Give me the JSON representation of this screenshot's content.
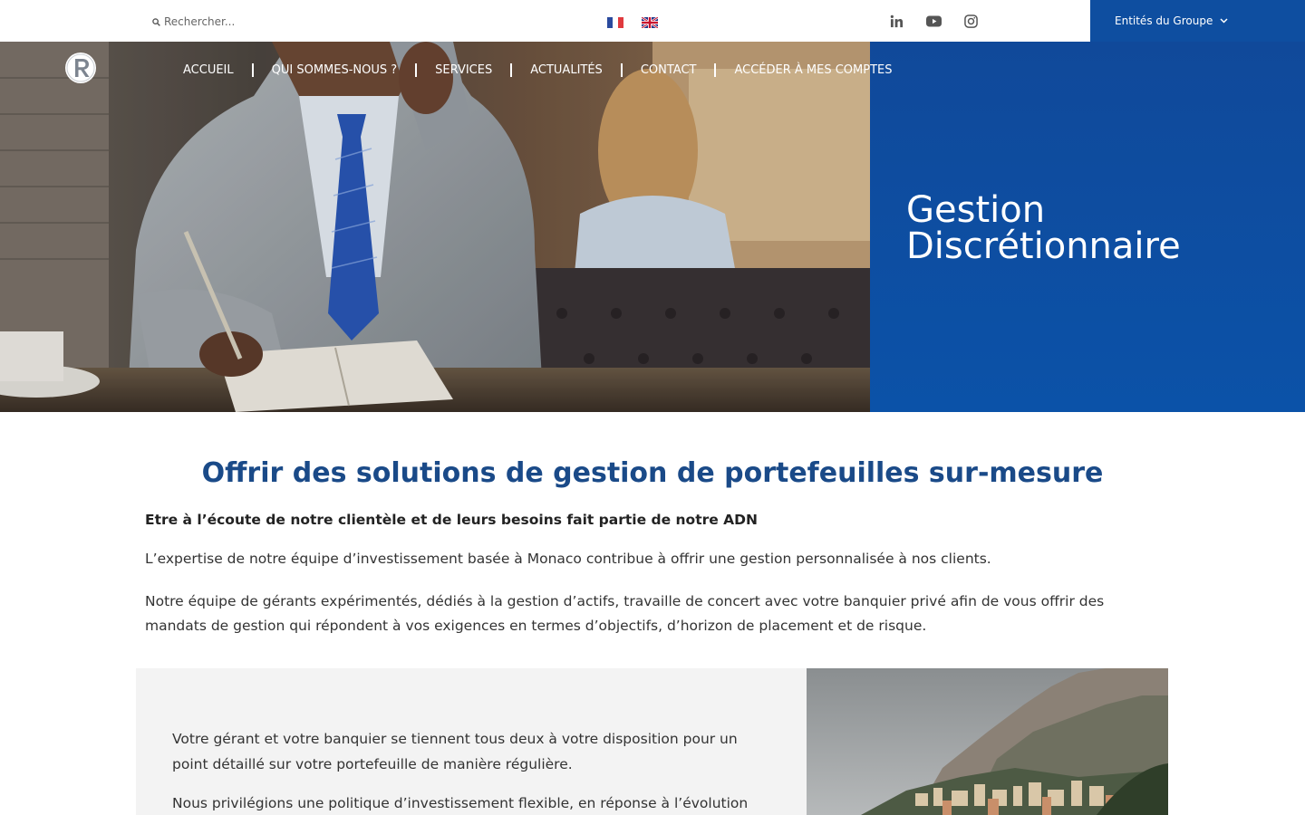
{
  "topbar": {
    "search_placeholder": "Rechercher...",
    "languages": [
      "fr",
      "en"
    ],
    "socials": [
      "linkedin-icon",
      "youtube-icon",
      "instagram-icon"
    ],
    "entities_label": "Entités du Groupe"
  },
  "nav": {
    "items": [
      "ACCUEIL",
      "QUI SOMMES-NOUS ?",
      "SERVICES",
      "ACTUALITÉS",
      "CONTACT",
      "ACCÉDER À MES COMPTES"
    ]
  },
  "hero": {
    "title_line1": "Gestion",
    "title_line2": "Discrétionnaire"
  },
  "content": {
    "headline": "Offrir des solutions de gestion de portefeuilles sur-mesure",
    "lead": "Etre à l’écoute de notre clientèle et de leurs besoins fait partie de notre ADN",
    "para1": "L’expertise de notre équipe d’investissement basée à Monaco contribue à offrir une gestion personnalisée à nos clients.",
    "para2": "Notre équipe de gérants expérimentés, dédiés à la gestion d’actifs, travaille de concert avec votre banquier privé afin de vous offrir des mandats de gestion qui répondent à vos exigences en termes d’objectifs, d’horizon de placement et de risque.",
    "card_para1": "Votre gérant et votre banquier se tiennent tous deux à votre disposition pour un point détaillé sur votre portefeuille de manière régulière.",
    "card_para2": "Nous privilégions une politique d’investissement flexible, en réponse à l’évolution des"
  },
  "colors": {
    "brand_blue": "#0e4ea0",
    "headline_blue": "#1a4a88"
  }
}
